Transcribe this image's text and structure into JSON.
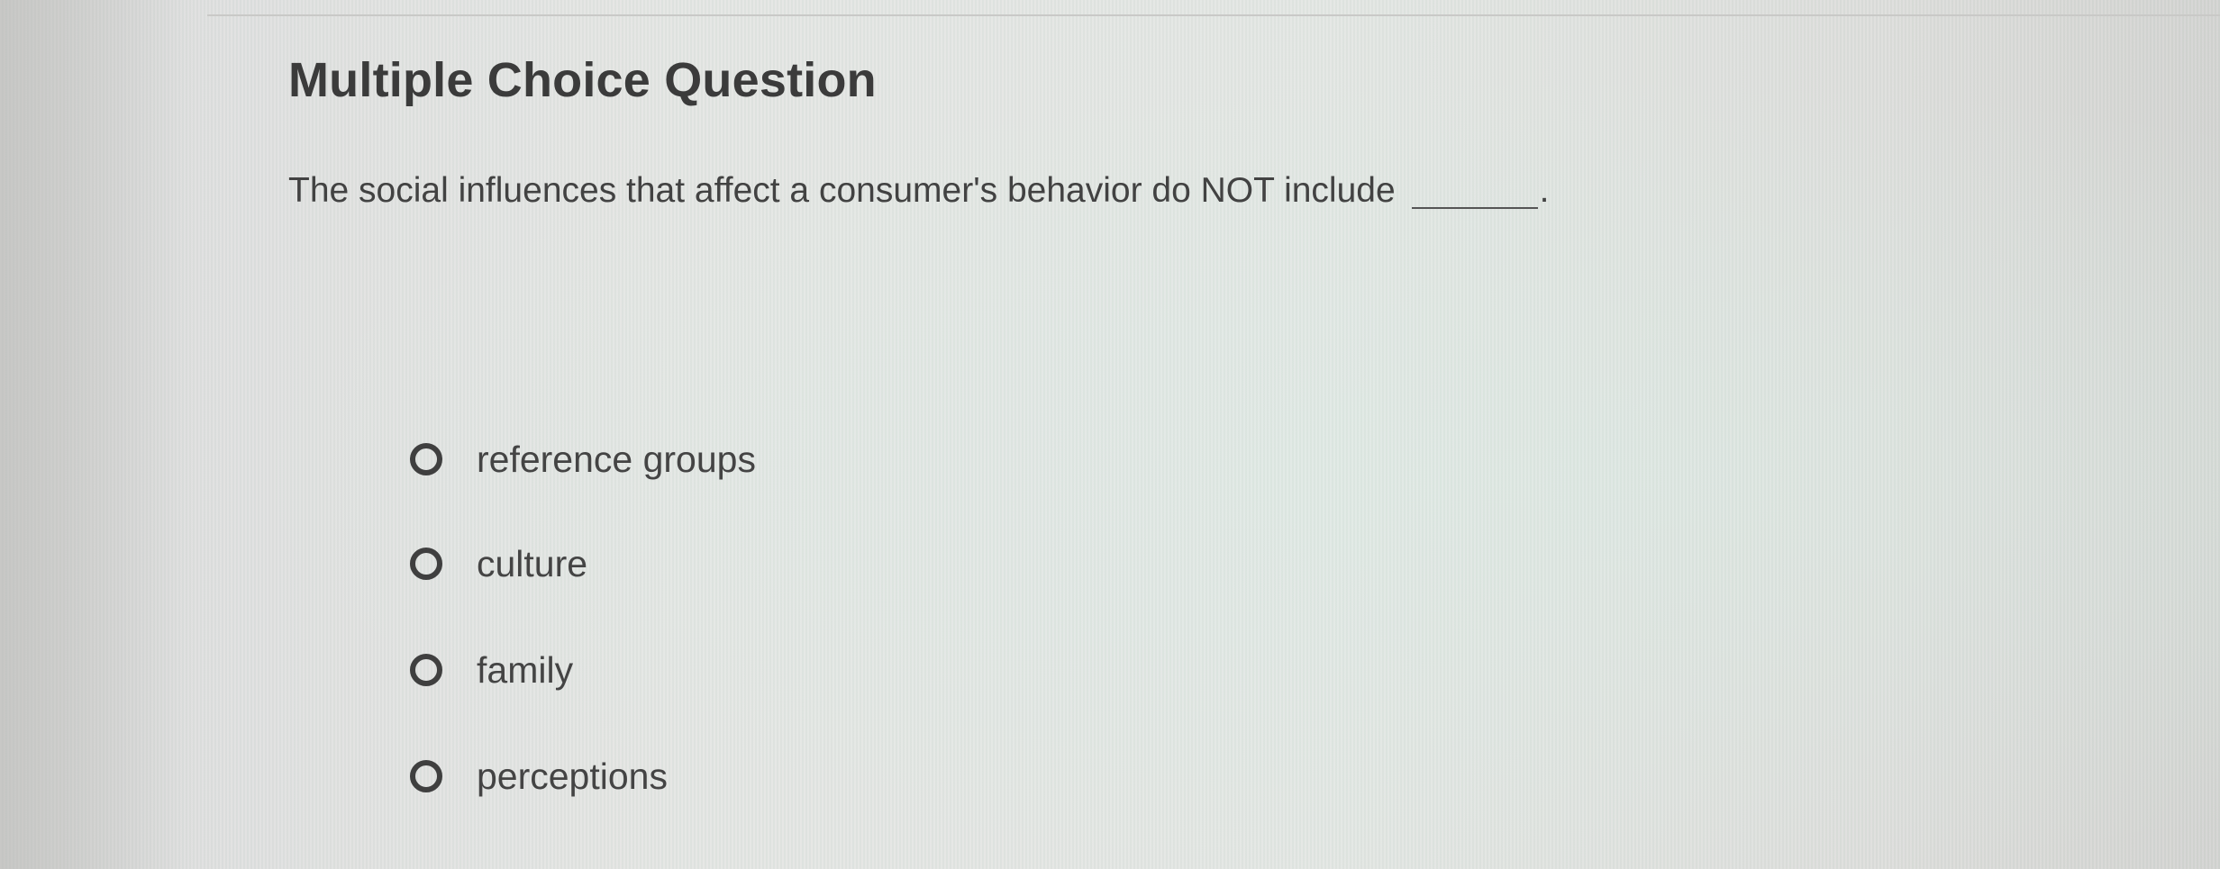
{
  "question": {
    "heading": "Multiple Choice Question",
    "prompt": "The social influences that affect a consumer's behavior do NOT include",
    "prompt_end": "."
  },
  "options": [
    {
      "label": "reference groups",
      "selected": false
    },
    {
      "label": "culture",
      "selected": false
    },
    {
      "label": "family",
      "selected": false
    },
    {
      "label": "perceptions",
      "selected": false
    }
  ],
  "colors": {
    "text": "#3b3b3b",
    "background": "#e2e5e2",
    "radio_border": "#3f3f3f"
  },
  "icons": [
    "radio-button-icon"
  ]
}
